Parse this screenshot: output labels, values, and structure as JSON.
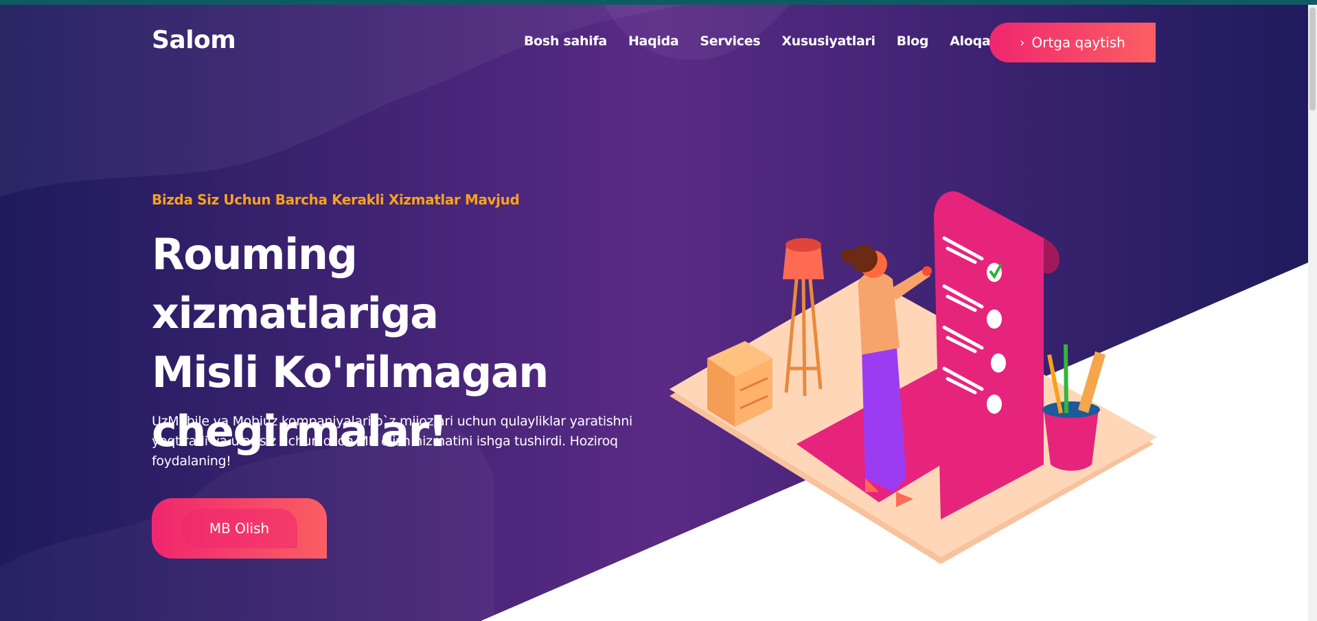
{
  "brand": {
    "logo": "Salom"
  },
  "nav": {
    "items": [
      "Bosh sahifa",
      "Haqida",
      "Services",
      "Xususiyatlari",
      "Blog",
      "Aloqa"
    ],
    "back_button": "Ortga qaytish"
  },
  "hero": {
    "subtitle": "Bizda Siz Uchun Barcha Kerakli Xizmatlar Mavjud",
    "headline": [
      "Rouming xizmatlariga",
      "Misli Ko'rilmagan",
      "chegirmalar!"
    ],
    "description": "UzMobile va Mobiuz kompaniyalari o`z mijozlari uchun qulayliklar yaratishni yoqtiradi va ular siz uchun oson MB olish hizmatini ishga tushirdi. Hoziroq foydalaning!",
    "cta": "MB Olish"
  },
  "colors": {
    "accent_gradient_start": "#f0266f",
    "accent_gradient_end": "#fb5f63",
    "subtitle": "#f7a21b",
    "bg_dark": "#1e1b5c",
    "bg_purple": "#5a2a85"
  },
  "icons": {
    "back": "chevron-right-icon"
  }
}
